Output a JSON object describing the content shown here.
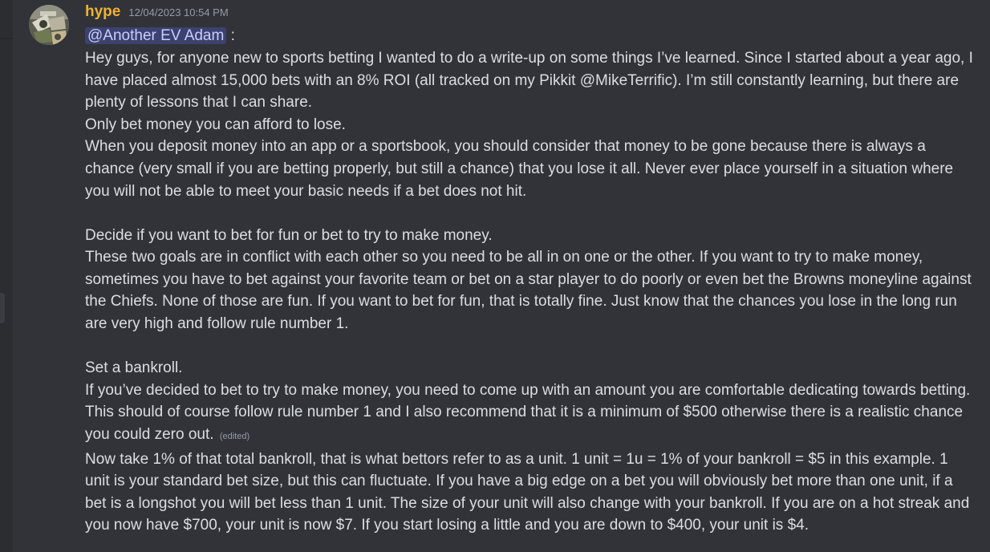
{
  "message": {
    "username": "hype",
    "timestamp": "12/04/2023 10:54 PM",
    "mention": "@Another EV Adam",
    "mention_suffix": " :",
    "intro": "Hey guys, for anyone new to sports betting I wanted to do a write-up on some things I’ve learned. Since I started about a year ago, I have placed almost 15,000 bets with an 8% ROI (all tracked on my Pikkit @MikeTerrific). I’m still constantly learning, but there are plenty of lessons that I can share.",
    "rule1_title": "Only bet money you can afford to lose.",
    "rule1_body": "When you deposit money into an app or a sportsbook, you should consider that money to be gone because there is always a chance (very small if you are betting properly, but still a chance) that you lose it all. Never ever place yourself in a situation where you will not be able to meet your basic needs if a bet does not hit.",
    "rule2_title": "Decide if you want to bet for fun or bet to try to make money.",
    "rule2_body": "These two goals are in conflict with each other so you need to be all in on one or the other. If you want to try to make money, sometimes you have to bet against your favorite team or bet on a star player to do poorly or even bet the Browns moneyline against the Chiefs. None of those are fun. If you want to bet for fun, that is totally fine. Just know that the chances you lose in the long run are very high and follow rule number 1.",
    "rule3_title": "Set a bankroll.",
    "rule3_body": "If you’ve decided to bet to try to make money, you need to come up with an amount you are comfortable dedicating towards betting. This should of course follow rule number 1 and I also recommend that it is a minimum of $500 otherwise there is a realistic chance you could zero out.",
    "edited_label": "(edited)",
    "unit_body": "Now take 1% of that total bankroll, that is what bettors refer to as a unit. 1 unit = 1u = 1% of your bankroll = $5 in this example. 1 unit is your standard bet size, but this can fluctuate. If you have a big edge on a bet you will obviously bet more than one unit, if a bet is a longshot you will bet less than 1 unit. The size of your unit will also change with your bankroll. If you are on a hot streak and you now have $700, your unit is now $7. If you start losing a little and you are down to $400, your unit is $4."
  },
  "colors": {
    "background": "#313338",
    "username": "#f0b232",
    "mention_bg": "#3c4270",
    "mention_text": "#c9cdfb",
    "text": "#dbdee1",
    "muted": "#949ba4"
  }
}
